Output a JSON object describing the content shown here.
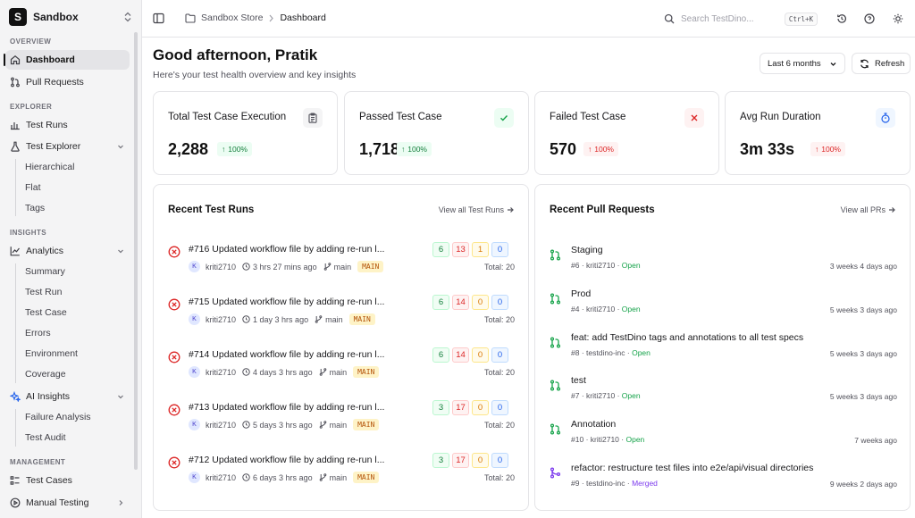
{
  "workspace": {
    "logo": "S",
    "name": "Sandbox"
  },
  "sidebar": {
    "overview_label": "OVERVIEW",
    "explorer_label": "EXPLORER",
    "insights_label": "INSIGHTS",
    "management_label": "MANAGEMENT",
    "dashboard": "Dashboard",
    "pull_requests": "Pull Requests",
    "test_runs": "Test Runs",
    "test_explorer": "Test Explorer",
    "explorer_sub": [
      "Hierarchical",
      "Flat",
      "Tags"
    ],
    "analytics": "Analytics",
    "analytics_sub": [
      "Summary",
      "Test Run",
      "Test Case",
      "Errors",
      "Environment",
      "Coverage"
    ],
    "ai_insights": "AI Insights",
    "ai_sub": [
      "Failure Analysis",
      "Test Audit"
    ],
    "test_cases": "Test Cases",
    "manual_testing": "Manual Testing"
  },
  "header": {
    "breadcrumb": [
      "Sandbox Store",
      "Dashboard"
    ],
    "search_placeholder": "Search TestDino...",
    "search_shortcut": "Ctrl+K"
  },
  "greeting": {
    "title": "Good afternoon, Pratik",
    "subtitle": "Here's your test health overview and key insights"
  },
  "controls": {
    "range": "Last 6 months",
    "refresh": "Refresh"
  },
  "stats": [
    {
      "title": "Total Test Case Execution",
      "value": "2,288",
      "change": "100%",
      "trend": "up",
      "icon": "clipboard-icon"
    },
    {
      "title": "Passed Test Case",
      "value": "1,718",
      "change": "100%",
      "trend": "up",
      "icon": "check-icon"
    },
    {
      "title": "Failed Test Case",
      "value": "570",
      "change": "100%",
      "trend": "up",
      "icon": "x-icon"
    },
    {
      "title": "Avg Run Duration",
      "value": "3m 33s",
      "change": "100%",
      "trend": "up",
      "icon": "timer-icon"
    }
  ],
  "recent_runs": {
    "title": "Recent Test Runs",
    "view_all": "View all Test Runs",
    "items": [
      {
        "title": "#716 Updated workflow file by adding re-run l...",
        "user": "kriti2710",
        "avatar": "K",
        "time": "3 hrs 27 mins ago",
        "branch": "main",
        "env": "MAIN",
        "passed": "6",
        "failed": "13",
        "flaky": "1",
        "skipped": "0",
        "total": "Total: 20"
      },
      {
        "title": "#715 Updated workflow file by adding re-run l...",
        "user": "kriti2710",
        "avatar": "K",
        "time": "1 day 3 hrs ago",
        "branch": "main",
        "env": "MAIN",
        "passed": "6",
        "failed": "14",
        "flaky": "0",
        "skipped": "0",
        "total": "Total: 20"
      },
      {
        "title": "#714 Updated workflow file by adding re-run l...",
        "user": "kriti2710",
        "avatar": "K",
        "time": "4 days 3 hrs ago",
        "branch": "main",
        "env": "MAIN",
        "passed": "6",
        "failed": "14",
        "flaky": "0",
        "skipped": "0",
        "total": "Total: 20"
      },
      {
        "title": "#713 Updated workflow file by adding re-run l...",
        "user": "kriti2710",
        "avatar": "K",
        "time": "5 days 3 hrs ago",
        "branch": "main",
        "env": "MAIN",
        "passed": "3",
        "failed": "17",
        "flaky": "0",
        "skipped": "0",
        "total": "Total: 20"
      },
      {
        "title": "#712 Updated workflow file by adding re-run l...",
        "user": "kriti2710",
        "avatar": "K",
        "time": "6 days 3 hrs ago",
        "branch": "main",
        "env": "MAIN",
        "passed": "3",
        "failed": "17",
        "flaky": "0",
        "skipped": "0",
        "total": "Total: 20"
      }
    ]
  },
  "recent_prs": {
    "title": "Recent Pull Requests",
    "view_all": "View all PRs",
    "items": [
      {
        "title": "Staging",
        "number": "#6",
        "author": "kriti2710",
        "status": "Open",
        "time": "3 weeks 4 days ago"
      },
      {
        "title": "Prod",
        "number": "#4",
        "author": "kriti2710",
        "status": "Open",
        "time": "5 weeks 3 days ago"
      },
      {
        "title": "feat: add TestDino tags and annotations to all test specs",
        "number": "#8",
        "author": "testdino-inc",
        "status": "Open",
        "time": "5 weeks 3 days ago"
      },
      {
        "title": "test",
        "number": "#7",
        "author": "kriti2710",
        "status": "Open",
        "time": "5 weeks 3 days ago"
      },
      {
        "title": "Annotation",
        "number": "#10",
        "author": "kriti2710",
        "status": "Open",
        "time": "7 weeks ago"
      },
      {
        "title": "refactor: restructure test files into e2e/api/visual directories",
        "number": "#9",
        "author": "testdino-inc",
        "status": "Merged",
        "time": "9 weeks 2 days ago"
      }
    ]
  },
  "colors": {
    "open": "#16a34a",
    "merged": "#7c3aed",
    "failed": "#dc2626",
    "passed": "#15803d"
  }
}
